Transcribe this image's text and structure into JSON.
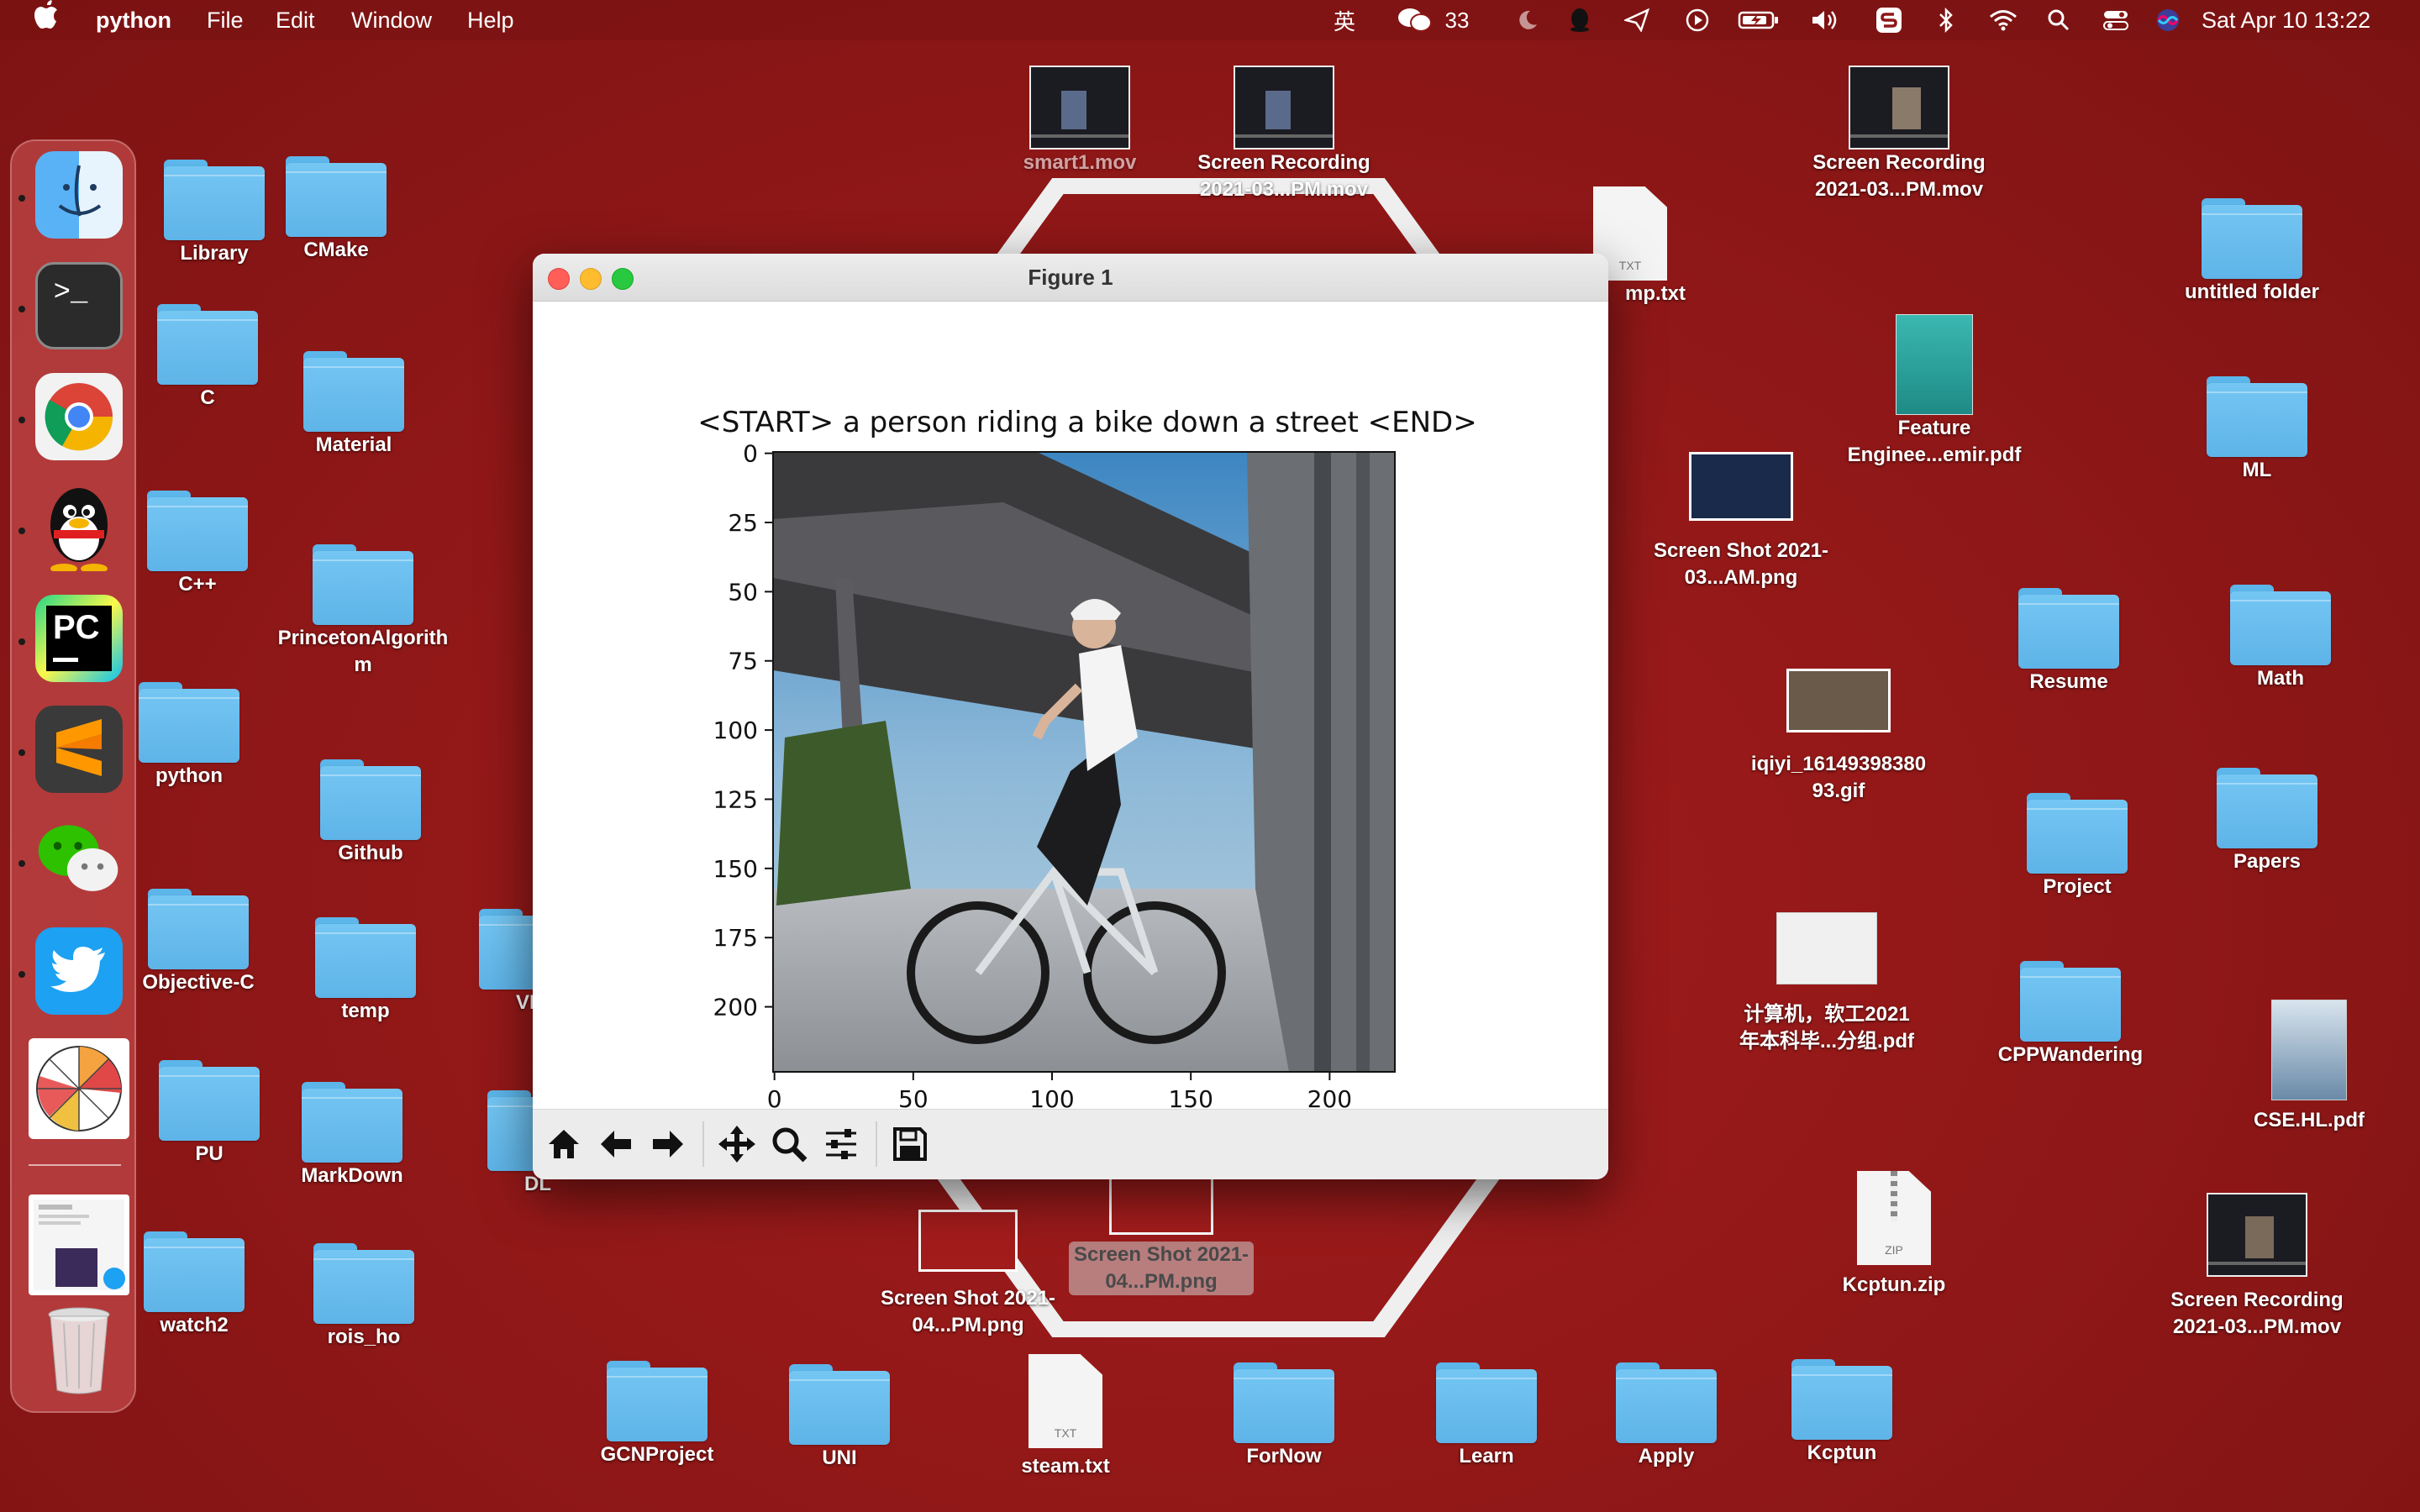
{
  "menubar": {
    "app_name": "python",
    "menus": [
      "File",
      "Edit",
      "Window",
      "Help"
    ],
    "input_method": "英",
    "wechat_count": "33",
    "datetime": "Sat Apr 10  13:22"
  },
  "desktop": {
    "folders": [
      {
        "label": "Library"
      },
      {
        "label": "CMake"
      },
      {
        "label": "C"
      },
      {
        "label": "Material"
      },
      {
        "label": "C++"
      },
      {
        "label": "PrincetonAlgorithm"
      },
      {
        "label": "python"
      },
      {
        "label": "Github"
      },
      {
        "label": "Objective-C"
      },
      {
        "label": "temp"
      },
      {
        "label": "PU"
      },
      {
        "label": "MarkDown"
      },
      {
        "label": "watch2"
      },
      {
        "label": "rois_ho"
      },
      {
        "label": "DL"
      },
      {
        "label": "VP"
      },
      {
        "label": "untitled folder"
      },
      {
        "label": "ML"
      },
      {
        "label": "Resume"
      },
      {
        "label": "Math"
      },
      {
        "label": "Project"
      },
      {
        "label": "Papers"
      },
      {
        "label": "CPPWandering"
      },
      {
        "label": "GCNProject"
      },
      {
        "label": "UNI"
      },
      {
        "label": "ForNow"
      },
      {
        "label": "Learn"
      },
      {
        "label": "Apply"
      },
      {
        "label": "Kcptun"
      }
    ],
    "files": [
      {
        "label": "smart1.mov"
      },
      {
        "label": "Screen Recording 2021-03...PM.mov"
      },
      {
        "label": "Screen Recording 2021-03...PM.mov"
      },
      {
        "label": "mp.txt",
        "ext": "TXT"
      },
      {
        "label": "Feature Enginee...emir.pdf"
      },
      {
        "label": "Screen Shot 2021-03...AM.png"
      },
      {
        "label": "iqiyi_1614939838093.gif"
      },
      {
        "label": "计算机，软工2021年本科毕...分组.pdf"
      },
      {
        "label": "CSE.HL.pdf"
      },
      {
        "label": "Kcptun.zip",
        "ext": "ZIP"
      },
      {
        "label": "Screen Recording 2021-03...PM.mov"
      },
      {
        "label": "Screen Shot 2021-04...PM.png"
      },
      {
        "label": "Screen Shot 2021-04...PM.png"
      },
      {
        "label": "steam.txt",
        "ext": "TXT"
      }
    ]
  },
  "figure_window": {
    "title": "Figure 1",
    "plot_title": "<START> a person riding a bike down a street <END>",
    "y_ticks": [
      "0",
      "25",
      "50",
      "75",
      "100",
      "125",
      "150",
      "175",
      "200"
    ],
    "x_ticks": [
      "0",
      "50",
      "100",
      "150",
      "200"
    ]
  },
  "dock": {
    "apps": [
      "Finder",
      "Terminal",
      "Chrome",
      "QQ",
      "PyCharm",
      "Sublime Text",
      "WeChat",
      "Twitter",
      "App",
      "Preview",
      "Trash"
    ]
  }
}
